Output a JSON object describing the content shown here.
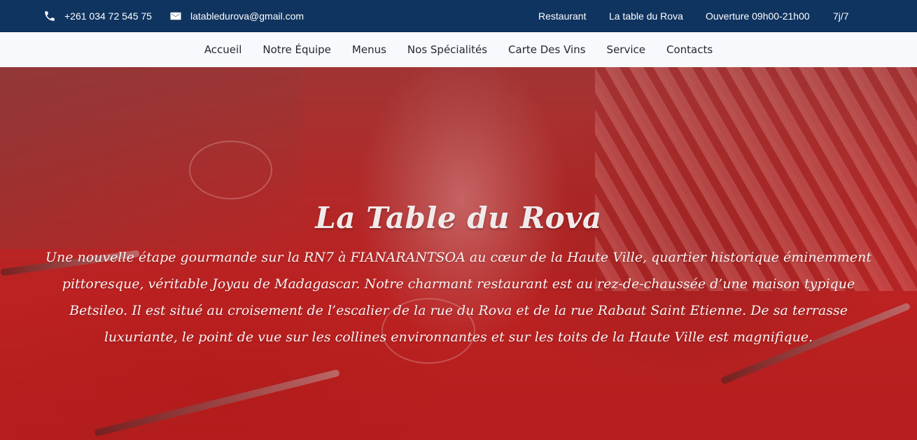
{
  "topbar": {
    "phone": "+261 034 72 545 75",
    "email": "latabledurova@gmail.com",
    "right_items": [
      "Restaurant",
      "La table du Rova",
      "Ouverture 09h00-21h00",
      "7j/7"
    ],
    "background_color": "#0f3460",
    "phone_icon": "phone-icon",
    "email_icon": "envelope-icon"
  },
  "nav": {
    "items": [
      "Accueil",
      "Notre Équipe",
      "Menus",
      "Nos Spécialités",
      "Carte Des Vins",
      "Service",
      "Contacts"
    ]
  },
  "hero": {
    "title": "La Table du Rova",
    "description": "Une nouvelle étape gourmande sur la RN7 à FIANARANTSOA au cœur de la Haute Ville, quartier historique éminemment pittoresque, véritable Joyau de Madagascar. Notre charmant restaurant est au rez-de-chaussée d’une maison typique Betsileo. Il est situé au croisement de l’escalier de la rue du Rova et de la rue Rabaut Saint Etienne. De sa terrasse luxuriante, le point de vue sur les collines environnantes et sur les toits de la Haute Ville est magnifique.",
    "overlay_color": "#b01414"
  }
}
